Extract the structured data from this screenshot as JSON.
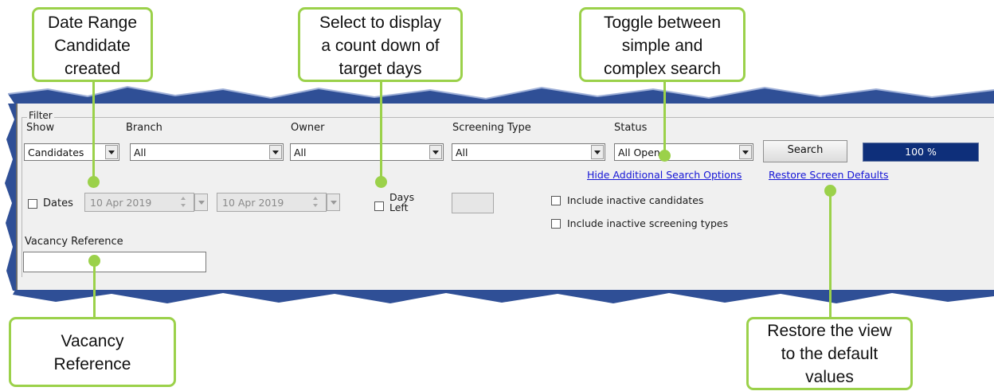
{
  "callouts": {
    "date_range": [
      "Date Range",
      "Candidate",
      "created"
    ],
    "days_left": [
      "Select to display",
      "a count down of",
      "target days"
    ],
    "toggle": [
      "Toggle between",
      "simple and",
      "complex search"
    ],
    "vacancy": [
      "Vacancy",
      "Reference"
    ],
    "restore": [
      "Restore the view",
      "to the default",
      "values"
    ]
  },
  "filter": {
    "group_label": "Filter",
    "show": {
      "label": "Show",
      "value": "Candidates"
    },
    "branch": {
      "label": "Branch",
      "value": "All"
    },
    "owner": {
      "label": "Owner",
      "value": "All"
    },
    "screening_type": {
      "label": "Screening Type",
      "value": "All"
    },
    "status": {
      "label": "Status",
      "value": "All Open"
    },
    "search_button": "Search",
    "progress": {
      "text": "100 %",
      "value": 1.0
    },
    "hide_options_link": "Hide Additional Search Options",
    "restore_defaults_link": "Restore Screen Defaults",
    "dates_label": "Dates",
    "date_from": "10 Apr 2019",
    "date_to": "10 Apr 2019",
    "days_left_label": [
      "Days",
      "Left"
    ],
    "days_left_value": "",
    "include_inactive_candidates": "Include inactive candidates",
    "include_inactive_screening": "Include inactive screening types",
    "vacancy_reference": {
      "label": "Vacancy Reference",
      "value": ""
    }
  },
  "colors": {
    "callout_border": "#9bd14a",
    "torn_band": "#2f4f96",
    "progress_fill": "#0e2f7a",
    "link": "#1515d6"
  }
}
